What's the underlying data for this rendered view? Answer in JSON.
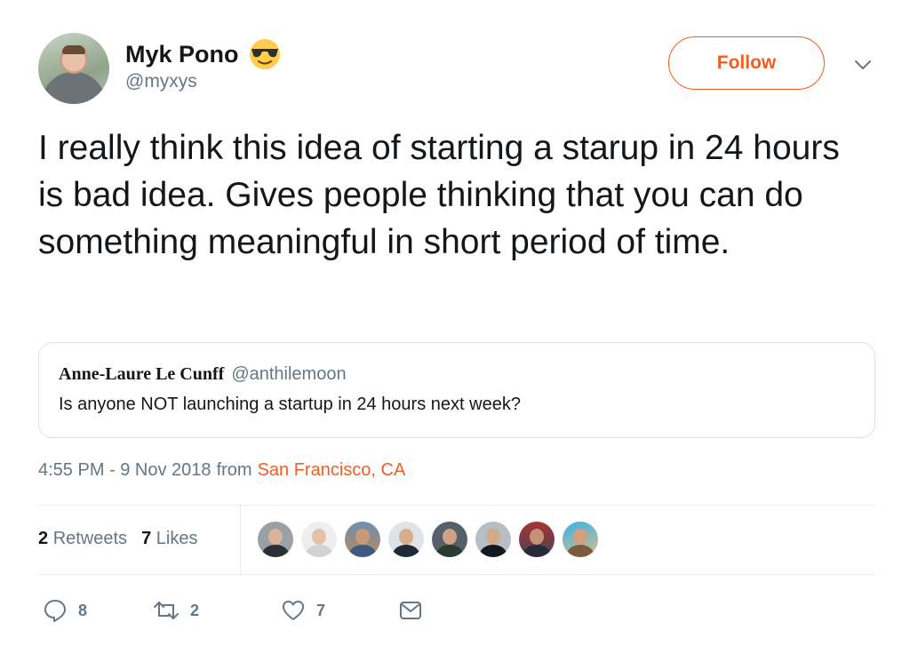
{
  "author": {
    "display_name": "Myk Pono",
    "handle": "@myxys",
    "avatar_icon": "user-avatar",
    "emoji": "smiling-face-with-sunglasses"
  },
  "follow_label": "Follow",
  "tweet_text": "I really think this idea of starting a starup in 24 hours is bad idea. Gives people thinking that you can do something meaningful in short period of time.",
  "quoted_tweet": {
    "name": "Anne-Laure Le Cunff",
    "handle": "@anthilemoon",
    "text": "Is anyone NOT launching a startup in 24 hours next week?"
  },
  "meta": {
    "timestamp": "4:55 PM - 9 Nov 2018",
    "from_label": "from",
    "location": "San Francisco, CA"
  },
  "stats": {
    "retweets_count": "2",
    "retweets_label": "Retweets",
    "likes_count": "7",
    "likes_label": "Likes"
  },
  "actions": {
    "reply_count": "8",
    "retweet_count": "2",
    "like_count": "7"
  },
  "colors": {
    "accent": "#f45d22",
    "secondary_text": "#657786",
    "border": "#e6ecf0"
  }
}
